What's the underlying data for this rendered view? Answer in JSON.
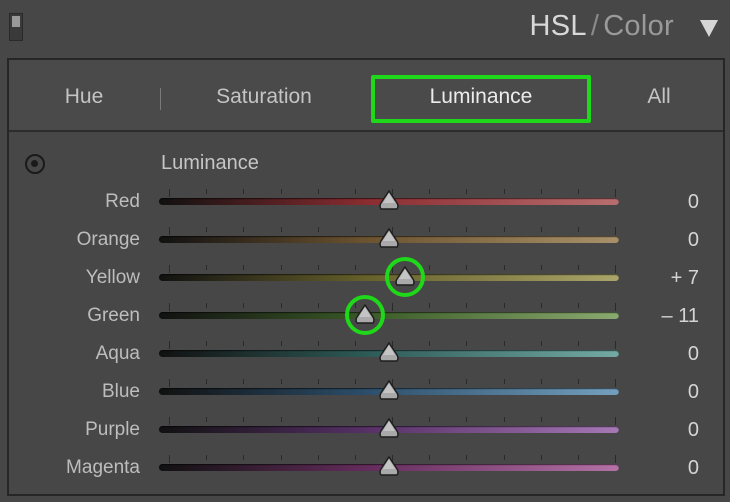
{
  "header": {
    "title_main": "HSL",
    "title_sep": "/",
    "title_sub": "Color"
  },
  "tabs": [
    {
      "label": "Hue",
      "active": false
    },
    {
      "label": "Saturation",
      "active": false
    },
    {
      "label": "Luminance",
      "active": true
    },
    {
      "label": "All",
      "active": false
    }
  ],
  "section": {
    "title": "Luminance"
  },
  "sliders": [
    {
      "label": "Red",
      "value": 0,
      "display": "0",
      "colors": [
        "#111111",
        "#8a2c30",
        "#b86e70"
      ],
      "highlighted": false
    },
    {
      "label": "Orange",
      "value": 0,
      "display": "0",
      "colors": [
        "#111111",
        "#6c5330",
        "#a8916a"
      ],
      "highlighted": false
    },
    {
      "label": "Yellow",
      "value": 7,
      "display": "+ 7",
      "colors": [
        "#111111",
        "#66602a",
        "#aaa56a"
      ],
      "highlighted": true
    },
    {
      "label": "Green",
      "value": -11,
      "display": "– 11",
      "colors": [
        "#111111",
        "#3a5a26",
        "#8aaa70"
      ],
      "highlighted": true
    },
    {
      "label": "Aqua",
      "value": 0,
      "display": "0",
      "colors": [
        "#111111",
        "#2d5a56",
        "#74aaa4"
      ],
      "highlighted": false
    },
    {
      "label": "Blue",
      "value": 0,
      "display": "0",
      "colors": [
        "#111111",
        "#2c4e6a",
        "#74a0be"
      ],
      "highlighted": false
    },
    {
      "label": "Purple",
      "value": 0,
      "display": "0",
      "colors": [
        "#111111",
        "#563066",
        "#a678b4"
      ],
      "highlighted": false
    },
    {
      "label": "Magenta",
      "value": 0,
      "display": "0",
      "colors": [
        "#111111",
        "#642c5c",
        "#b472a6"
      ],
      "highlighted": false
    }
  ],
  "slider_range": [
    -100,
    100
  ],
  "accent_highlight": "#1fd81a"
}
